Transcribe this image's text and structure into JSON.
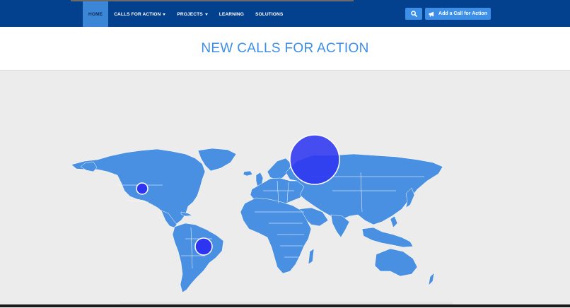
{
  "nav": {
    "items": [
      {
        "label": "HOME",
        "active": true
      },
      {
        "label": "CALLS FOR ACTION",
        "dropdown": true
      },
      {
        "label": "PROJECTS",
        "dropdown": true
      },
      {
        "label": "LEARNING"
      },
      {
        "label": "SOLUTIONS"
      }
    ],
    "search_icon": "search-icon",
    "add_button_label": "Add a Call for Action",
    "add_button_icon": "megaphone-icon"
  },
  "page": {
    "title": "NEW CALLS FOR ACTION"
  },
  "map": {
    "land_color": "#4a90e2",
    "bubble_color": "#2e35f0",
    "bubbles": [
      {
        "region": "Russia",
        "size": "large"
      },
      {
        "region": "United States",
        "size": "small"
      },
      {
        "region": "Brazil",
        "size": "medium"
      }
    ]
  },
  "colors": {
    "navbar": "#03408d",
    "accent": "#3c8ee6",
    "background": "#ececec"
  }
}
